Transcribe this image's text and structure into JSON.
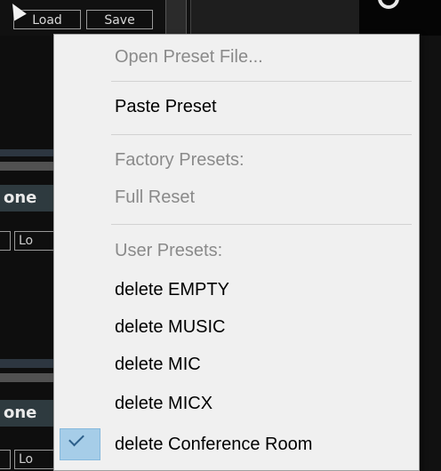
{
  "background": {
    "top_buttons": [
      "Load",
      "Save"
    ],
    "channel_label_1": "one",
    "channel_label_2": "one",
    "small_button_label": "Lo"
  },
  "menu": {
    "items": [
      {
        "label": "Open Preset File...",
        "enabled": false,
        "checked": false
      },
      {
        "label": "Paste Preset",
        "enabled": true,
        "checked": false
      },
      {
        "label": "Factory Presets:",
        "enabled": false,
        "checked": false
      },
      {
        "label": "Full Reset",
        "enabled": false,
        "checked": false
      },
      {
        "label": "User Presets:",
        "enabled": false,
        "checked": false
      },
      {
        "label": "delete EMPTY",
        "enabled": true,
        "checked": false
      },
      {
        "label": "delete MUSIC",
        "enabled": true,
        "checked": false
      },
      {
        "label": "delete MIC",
        "enabled": true,
        "checked": false
      },
      {
        "label": "delete MICX",
        "enabled": true,
        "checked": false
      },
      {
        "label": "delete Conference Room",
        "enabled": true,
        "checked": true
      }
    ],
    "check_icon": "check-mark-icon"
  },
  "colors": {
    "menu_background": "#f0f0f0",
    "disabled_text": "#8a8a8a",
    "checked_highlight": "#a6cde8"
  }
}
